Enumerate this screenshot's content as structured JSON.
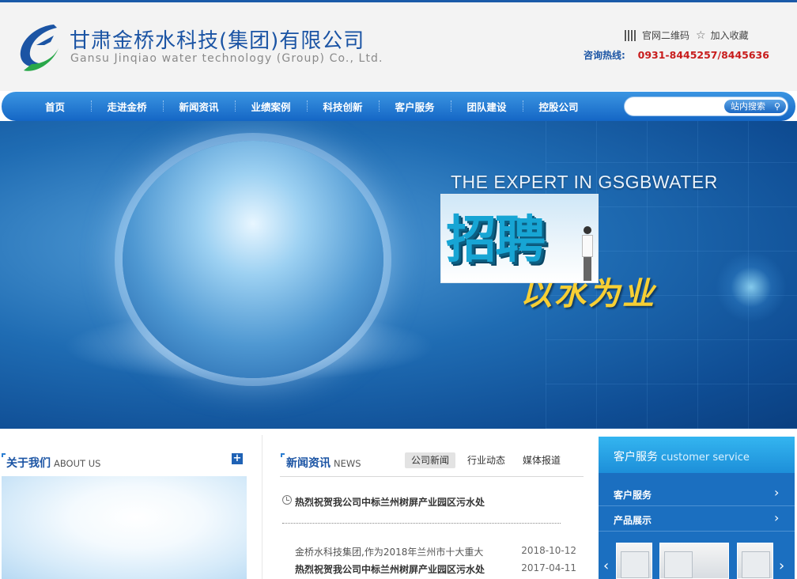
{
  "header": {
    "brand_cn": "甘肃金桥水科技(集团)有限公司",
    "brand_en": "Gansu Jinqiao water technology (Group) Co., Ltd.",
    "qr_label": "官网二维码",
    "favorite_label": "加入收藏",
    "hotline_label": "咨询热线:",
    "hotline_number": "0931-8445257/8445636"
  },
  "nav": {
    "items": [
      "首页",
      "走进金桥",
      "新闻资讯",
      "业绩案例",
      "科技创新",
      "客户服务",
      "团队建设",
      "控股公司"
    ],
    "search_placeholder": "",
    "search_button": "站内搜索"
  },
  "banner": {
    "tagline": "THE EXPERT IN GSGBWATER",
    "slogan": "以水为业",
    "popup_text": "招聘"
  },
  "about": {
    "title": "关于我们",
    "title_en": "ABOUT US"
  },
  "news": {
    "title": "新闻资讯",
    "title_en": "NEWS",
    "tabs": [
      "公司新闻",
      "行业动态",
      "媒体报道"
    ],
    "active_tab": "公司新闻",
    "headline": "热烈祝贺我公司中标兰州树屏产业园区污水处",
    "items": [
      {
        "title": "金桥水科技集团,作为2018年兰州市十大重大",
        "date": "2018-10-12"
      },
      {
        "title": "热烈祝贺我公司中标兰州树屏产业园区污水处",
        "date": "2017-04-11"
      }
    ]
  },
  "service": {
    "title": "客户服务",
    "title_en": "customer service",
    "rows": [
      "客户服务",
      "产品展示"
    ]
  },
  "colors": {
    "brand_blue": "#1b54a4",
    "hotline_red": "#c81c1c",
    "nav_blue": "#1466c5",
    "service_blue": "#1b6fc0"
  }
}
